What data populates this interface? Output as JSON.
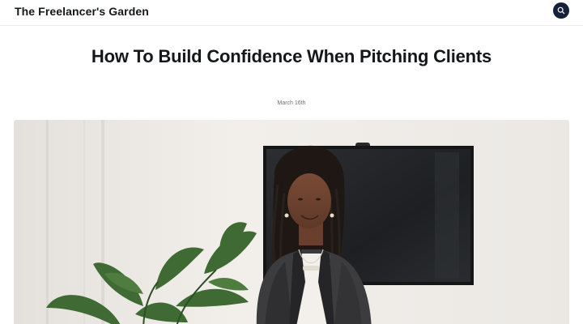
{
  "site": {
    "title": "The Freelancer's Garden",
    "search_icon": "search-icon"
  },
  "post": {
    "title": "How To Build Confidence When Pitching Clients",
    "date": "March 16th",
    "feature_image": "photo"
  },
  "colors": {
    "text": "#15171a",
    "accent": "#15203a",
    "muted": "#6b6f76",
    "border": "#ececec"
  }
}
